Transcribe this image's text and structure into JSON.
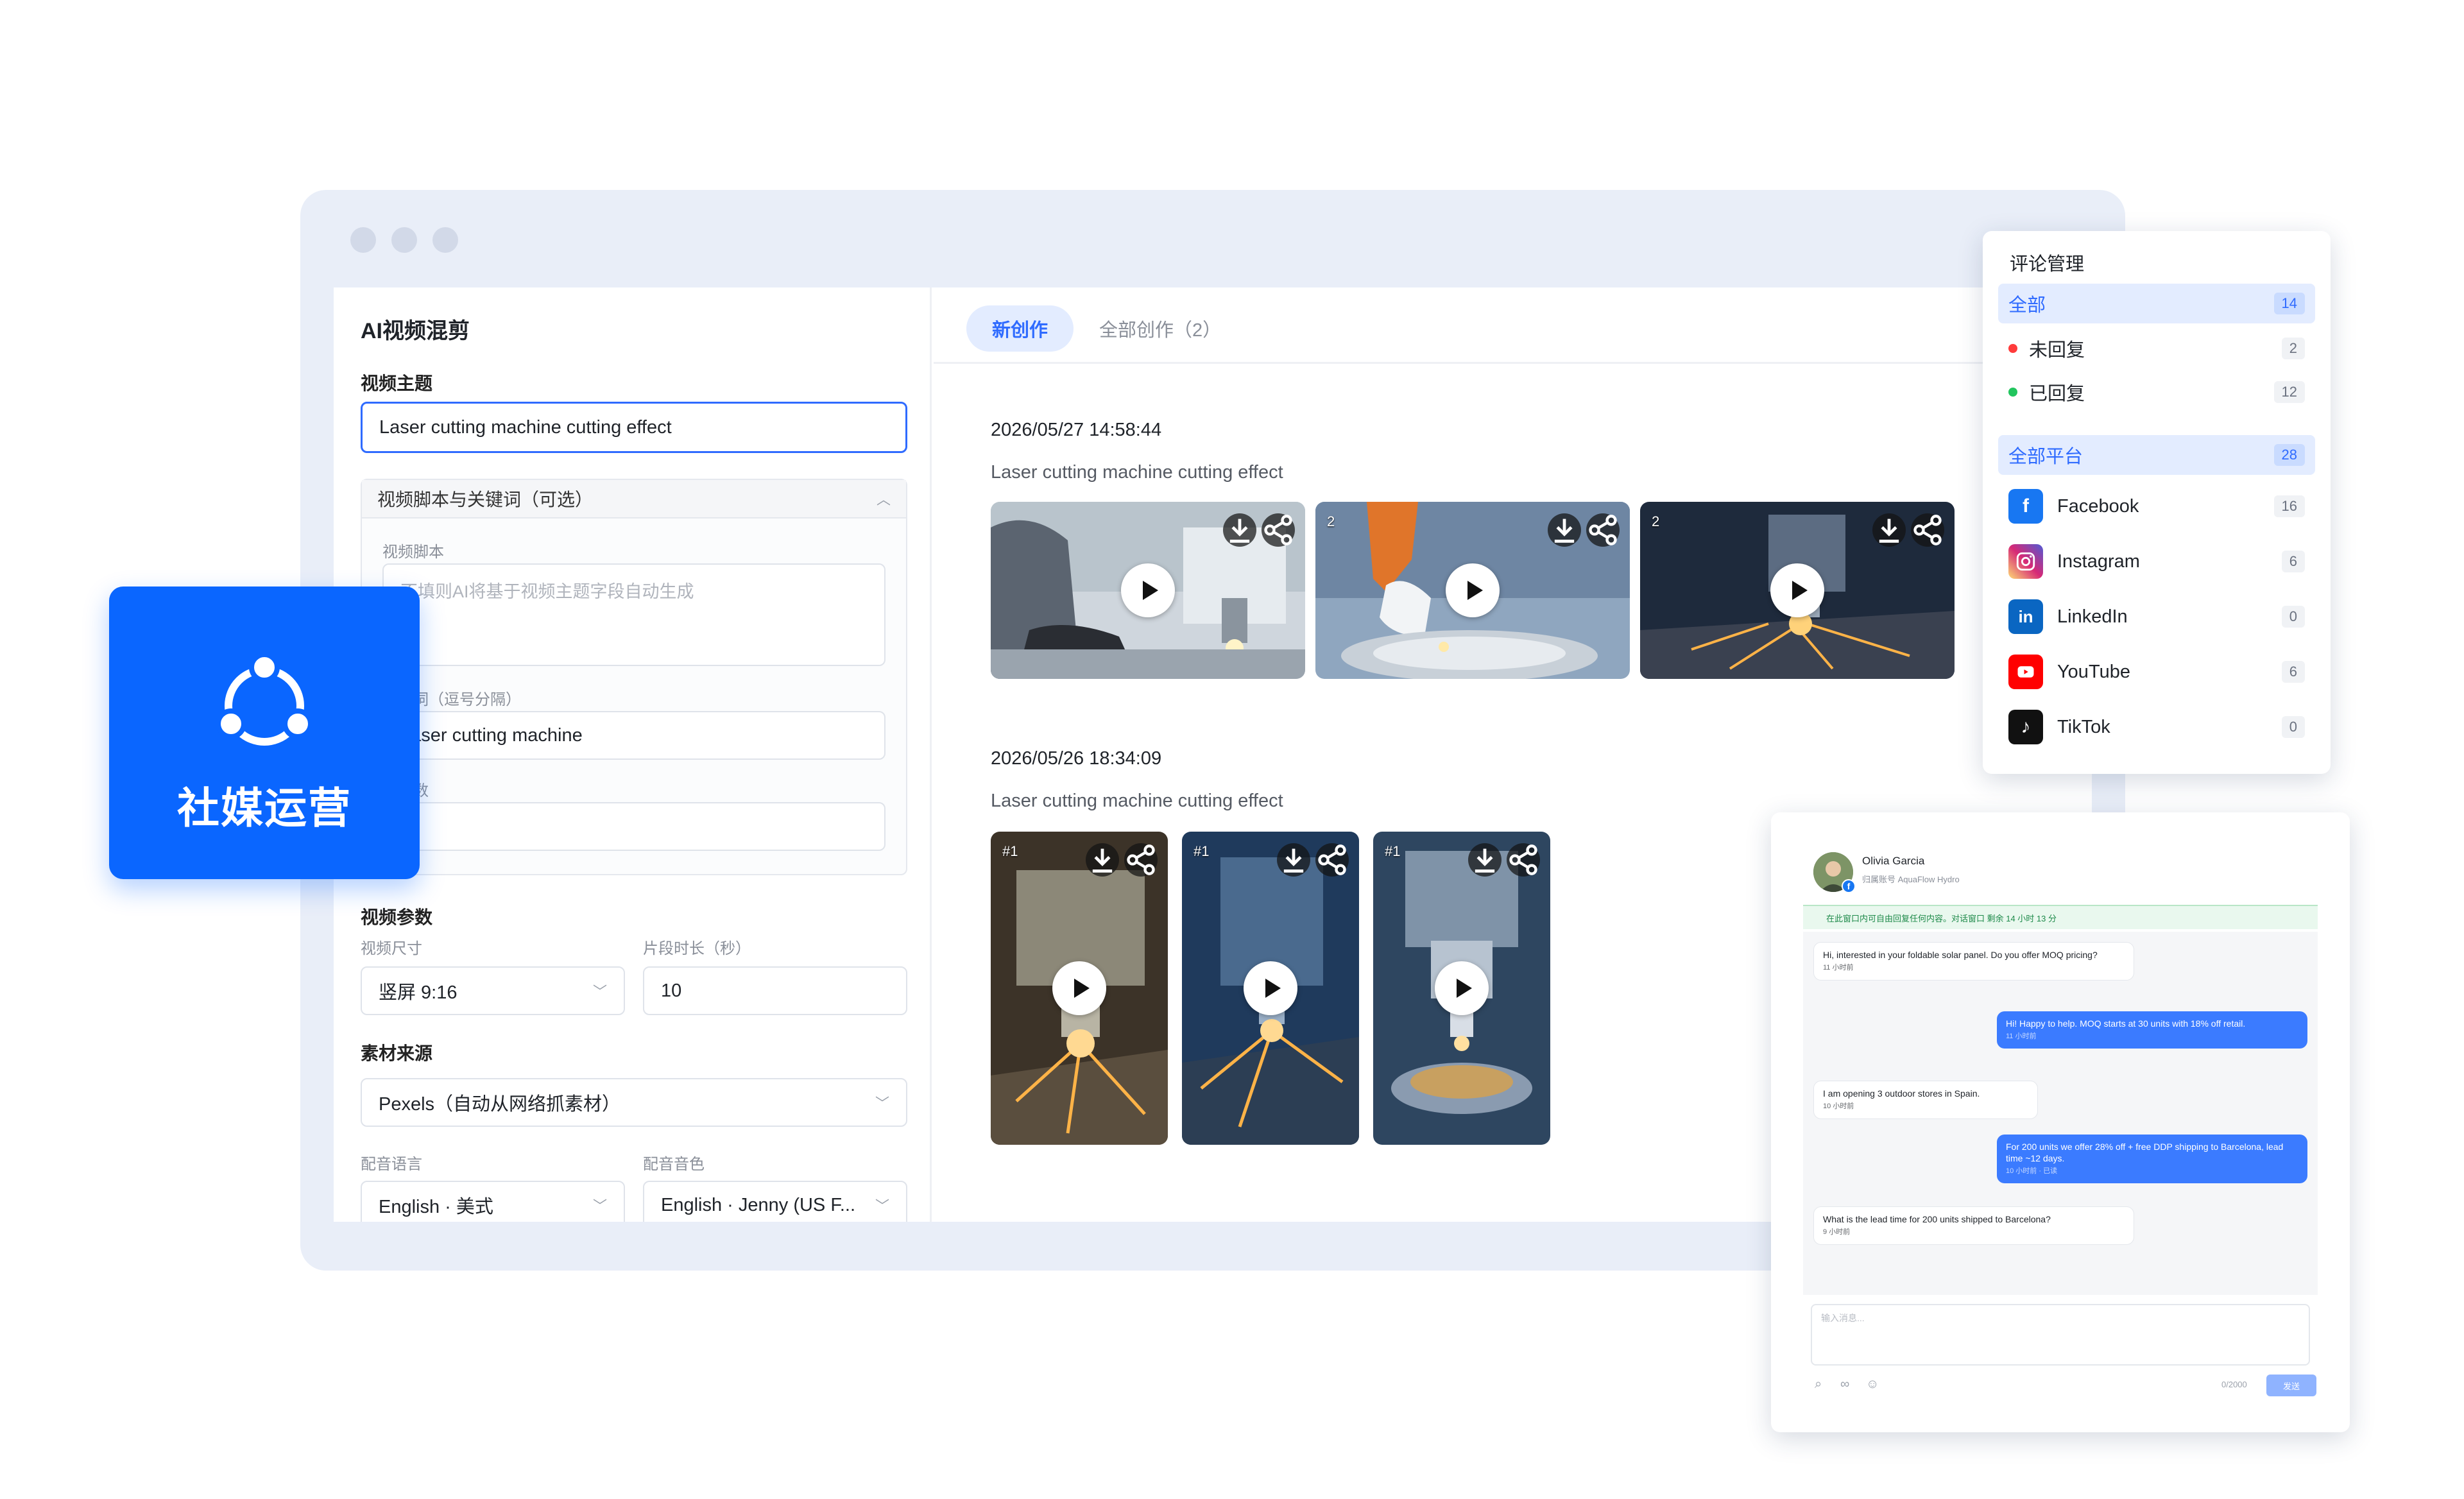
{
  "left": {
    "title": "AI视频混剪",
    "topic_label": "视频主题",
    "topic_value": "Laser cutting machine cutting effect",
    "script_panel_title": "视频脚本与关键词（可选）",
    "script_label": "视频脚本",
    "script_placeholder": "不填则AI将基于视频主题字段自动生成",
    "keywords_label": "关键词（逗号分隔）",
    "keywords_value": "Laser cutting machine",
    "count_label": "段落数",
    "count_value": "",
    "params_label": "视频参数",
    "size_label": "视频尺寸",
    "size_value": "竖屏 9:16",
    "duration_label": "片段时长（秒）",
    "duration_value": "10",
    "source_label": "素材来源",
    "source_value": "Pexels（自动从网络抓素材）",
    "voice_lang_label": "配音语言",
    "voice_lang_value": "English · 美式",
    "voice_label": "配音音色",
    "voice_value": "English · Jenny (US F..."
  },
  "tabs": [
    {
      "label": "新创作",
      "active": true
    },
    {
      "label": "全部创作（2）",
      "active": false
    }
  ],
  "creations": [
    {
      "time": "2026/05/27 14:58:44",
      "caption": "Laser cutting machine cutting effect",
      "thumbs": [
        {
          "num": "",
          "scene": "worker"
        },
        {
          "num": "2",
          "scene": "robot"
        },
        {
          "num": "2",
          "scene": "sparks"
        }
      ]
    },
    {
      "time": "2026/05/26 18:34:09",
      "caption": "Laser cutting machine cutting effect",
      "thumbs": [
        {
          "num": "#1",
          "scene": "head"
        },
        {
          "num": "#1",
          "scene": "sheet"
        },
        {
          "num": "#1",
          "scene": "spindle"
        }
      ]
    }
  ],
  "logo": {
    "label": "社媒运营",
    "color": "#0a66ff"
  },
  "comments": {
    "title": "评论管理",
    "status": [
      {
        "label": "全部",
        "count": "14",
        "active": true,
        "dot": ""
      },
      {
        "label": "未回复",
        "count": "2",
        "active": false,
        "dot": "#ff3b3b"
      },
      {
        "label": "已回复",
        "count": "12",
        "active": false,
        "dot": "#22c55e"
      }
    ],
    "platforms": [
      {
        "label": "全部平台",
        "count": "28",
        "active": true,
        "icon": "",
        "color": ""
      },
      {
        "label": "Facebook",
        "count": "16",
        "active": false,
        "icon": "facebook-icon",
        "color": "#1877f2"
      },
      {
        "label": "Instagram",
        "count": "6",
        "active": false,
        "icon": "instagram-icon",
        "color": "#d62976"
      },
      {
        "label": "LinkedIn",
        "count": "0",
        "active": false,
        "icon": "linkedin-icon",
        "color": "#0a66c2"
      },
      {
        "label": "YouTube",
        "count": "6",
        "active": false,
        "icon": "youtube-icon",
        "color": "#ff0000"
      },
      {
        "label": "TikTok",
        "count": "0",
        "active": false,
        "icon": "tiktok-icon",
        "color": "#111111"
      }
    ]
  },
  "chat": {
    "name": "Olivia Garcia",
    "sub": "归属账号 AquaFlow Hydro",
    "notice": "在此窗口内可自由回复任何内容。对话窗口 剩余 14 小时 13 分",
    "messages": [
      {
        "dir": "in",
        "text": "Hi, interested in your foldable solar panel. Do you offer MOQ pricing?",
        "time": "11 小时前"
      },
      {
        "dir": "out",
        "text": "Hi! Happy to help. MOQ starts at 30 units with 18% off retail.",
        "time": "11 小时前"
      },
      {
        "dir": "in",
        "text": "I am opening 3 outdoor stores in Spain.",
        "time": "10 小时前"
      },
      {
        "dir": "out",
        "text": "For 200 units we offer 28% off + free DDP shipping to Barcelona, lead time ~12 days.",
        "time": "10 小时前 · 已读"
      },
      {
        "dir": "in",
        "text": "What is the lead time for 200 units shipped to Barcelona?",
        "time": "9 小时前"
      }
    ],
    "input_placeholder": "输入消息...",
    "counter": "0/2000",
    "send_label": "发送"
  }
}
